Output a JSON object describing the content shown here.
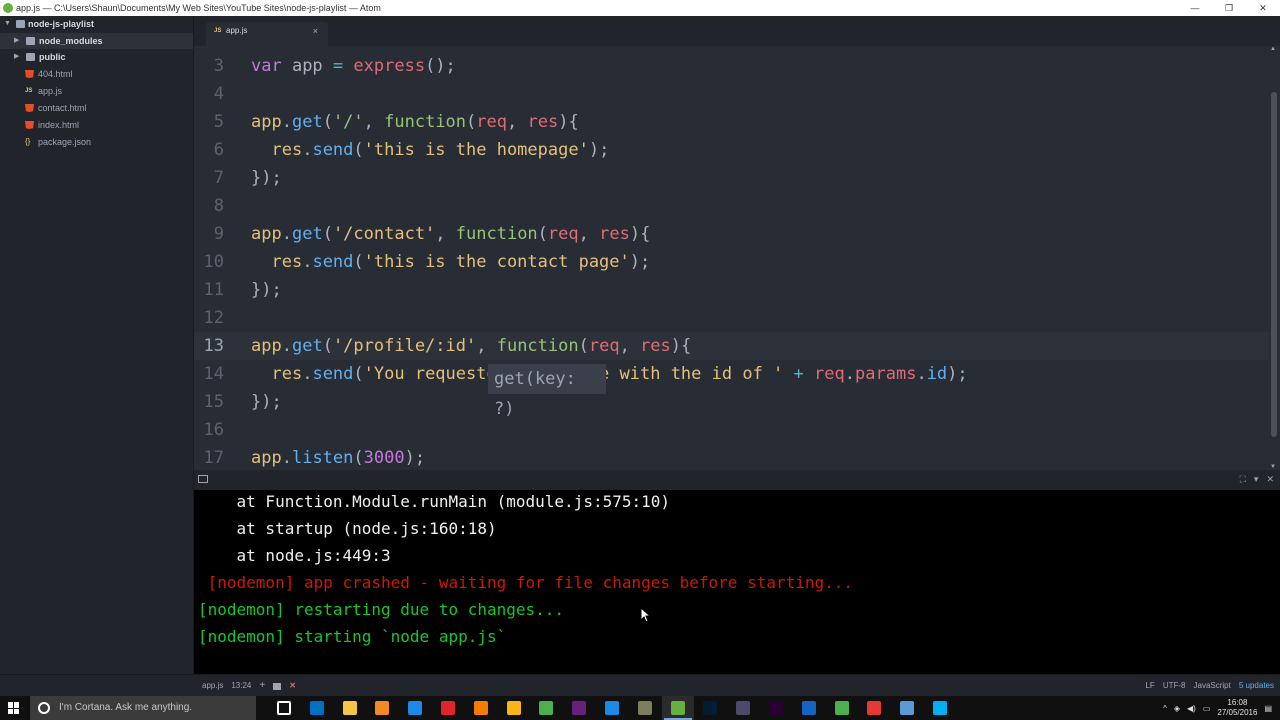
{
  "window": {
    "title": "app.js — C:\\Users\\Shaun\\Documents\\My Web Sites\\YouTube Sites\\node-js-playlist — Atom",
    "controls": [
      "—",
      "❐",
      "✕"
    ]
  },
  "tree": {
    "root": "node-js-playlist",
    "items": [
      {
        "label": "node_modules",
        "type": "folder",
        "expanded": false
      },
      {
        "label": "public",
        "type": "folder",
        "expanded": false
      },
      {
        "label": "404.html",
        "type": "html"
      },
      {
        "label": "app.js",
        "type": "js"
      },
      {
        "label": "contact.html",
        "type": "html"
      },
      {
        "label": "index.html",
        "type": "html"
      },
      {
        "label": "package.json",
        "type": "json"
      }
    ]
  },
  "tab": {
    "label": "app.js",
    "icon": "JS",
    "close": "×"
  },
  "editor": {
    "line_numbers": [
      "3",
      "4",
      "5",
      "6",
      "7",
      "8",
      "9",
      "10",
      "11",
      "12",
      "13",
      "14",
      "15",
      "16",
      "17"
    ],
    "active_line": "13",
    "tooltip": "get(key: ?)"
  },
  "terminal": {
    "lines": [
      {
        "text": "    at Function.Module.runMain (module.js:575:10)",
        "color": "#f0f0f0"
      },
      {
        "text": "    at startup (node.js:160:18)",
        "color": "#f0f0f0"
      },
      {
        "text": "    at node.js:449:3",
        "color": "#f0f0f0"
      },
      {
        "text": " [nodemon] app crashed - waiting for file changes before starting...",
        "color": "#c91b00"
      },
      {
        "text": "[nodemon] restarting due to changes...",
        "color": "#14c82a"
      },
      {
        "text": "[nodemon] starting `node app.js`",
        "color": "#14c82a"
      }
    ]
  },
  "statusbar": {
    "file": "app.js",
    "cursor": "13:24",
    "line_ending": "LF",
    "encoding": "UTF-8",
    "grammar": "JavaScript",
    "updates": "5 updates"
  },
  "taskbar": {
    "cortana_placeholder": "I'm Cortana. Ask me anything.",
    "apps": [
      {
        "name": "task-view",
        "color": "#ffffff"
      },
      {
        "name": "outlook",
        "color": "#0072c6"
      },
      {
        "name": "file-explorer",
        "color": "#f3c744"
      },
      {
        "name": "store",
        "color": "#f28a24"
      },
      {
        "name": "edge",
        "color": "#1e88e5"
      },
      {
        "name": "opera",
        "color": "#e0242c"
      },
      {
        "name": "firefox",
        "color": "#f57c00"
      },
      {
        "name": "chrome-canary",
        "color": "#f9b418"
      },
      {
        "name": "chrome",
        "color": "#4caf50"
      },
      {
        "name": "visual-studio",
        "color": "#68217a"
      },
      {
        "name": "app-generic",
        "color": "#1e88e5"
      },
      {
        "name": "app-generic-2",
        "color": "#7e7e5c"
      },
      {
        "name": "atom",
        "color": "#66b03d"
      },
      {
        "name": "photoshop",
        "color": "#001d34"
      },
      {
        "name": "app-circle",
        "color": "#4a4a6a"
      },
      {
        "name": "premiere",
        "color": "#2a0033"
      },
      {
        "name": "media-player",
        "color": "#1565c0"
      },
      {
        "name": "maps-app",
        "color": "#4caf50"
      },
      {
        "name": "app-red",
        "color": "#e53935"
      },
      {
        "name": "app-blue",
        "color": "#5c9ad6"
      },
      {
        "name": "skype",
        "color": "#00aff0"
      }
    ],
    "time": "16:08",
    "date": "27/05/2016"
  }
}
